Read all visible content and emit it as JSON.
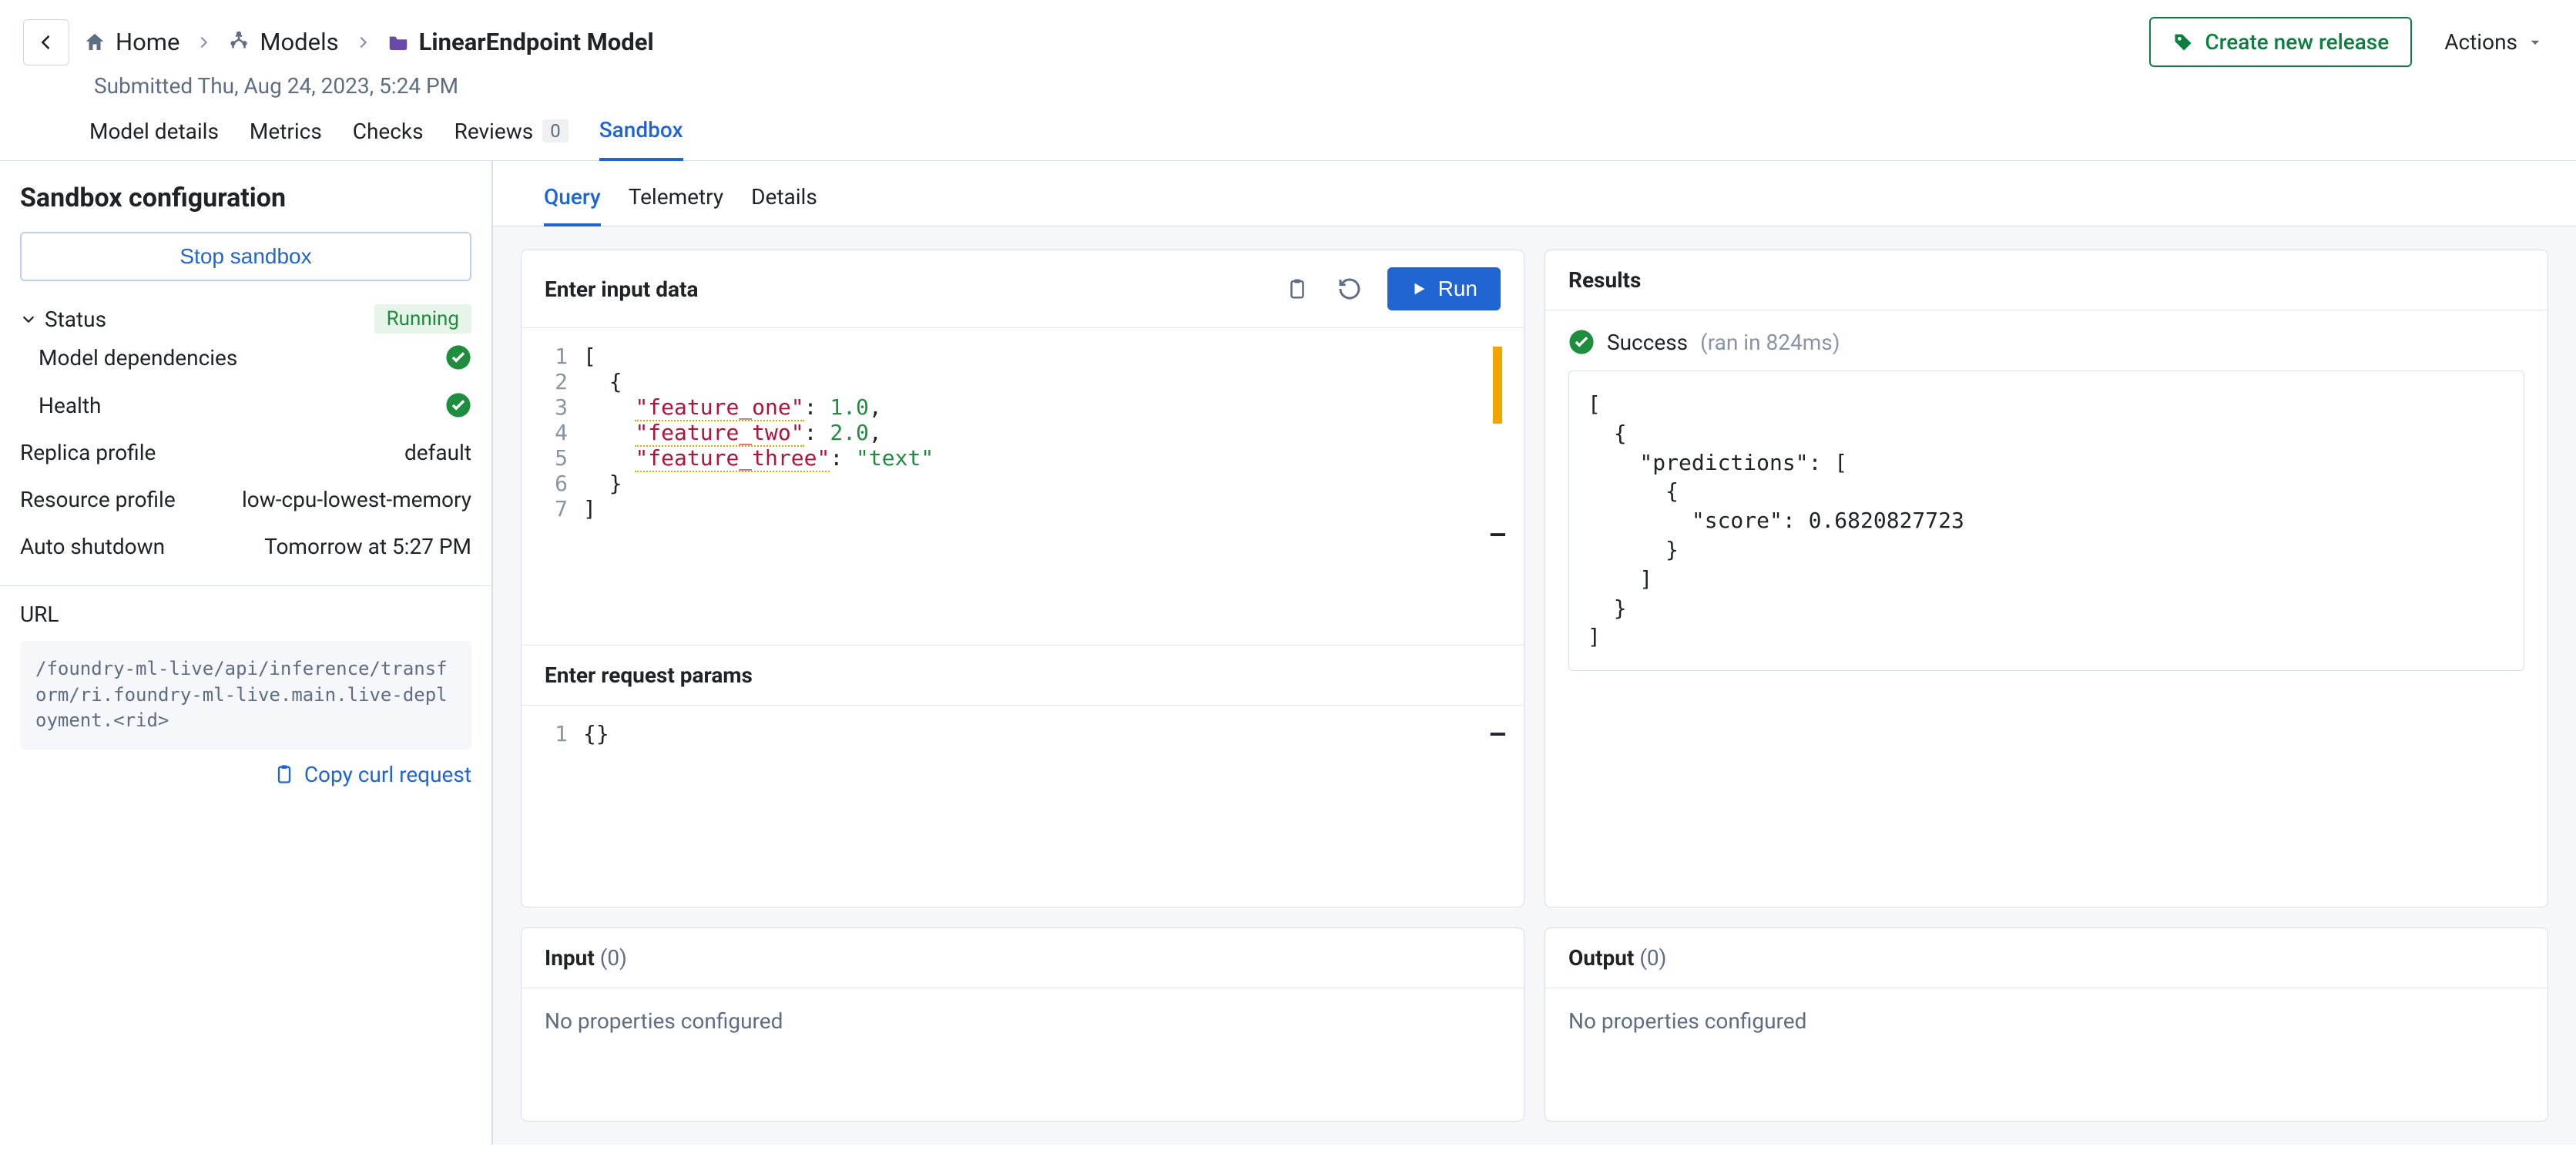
{
  "breadcrumb": {
    "home": "Home",
    "models": "Models",
    "current": "LinearEndpoint Model"
  },
  "submitted": "Submitted Thu, Aug 24, 2023, 5:24 PM",
  "header_buttons": {
    "create_release": "Create new release",
    "actions": "Actions"
  },
  "primary_tabs": {
    "model_details": "Model details",
    "metrics": "Metrics",
    "checks": "Checks",
    "reviews": "Reviews",
    "reviews_count": "0",
    "sandbox": "Sandbox"
  },
  "sidebar": {
    "title": "Sandbox configuration",
    "stop": "Stop sandbox",
    "status_label": "Status",
    "status_badge": "Running",
    "model_deps": "Model dependencies",
    "health": "Health",
    "replica_label": "Replica profile",
    "replica_value": "default",
    "resource_label": "Resource profile",
    "resource_value": "low-cpu-lowest-memory",
    "shutdown_label": "Auto shutdown",
    "shutdown_value": "Tomorrow at 5:27 PM",
    "url_label": "URL",
    "url_value": "/foundry-ml-live/api/inference/transform/ri.foundry-ml-live.main.live-deployment.<rid>",
    "copy": "Copy curl request"
  },
  "sub_tabs": {
    "query": "Query",
    "telemetry": "Telemetry",
    "details": "Details"
  },
  "query": {
    "input_title": "Enter input data",
    "run": "Run",
    "code": {
      "f1_key": "\"feature_one\"",
      "f1_val": "1.0",
      "f2_key": "\"feature_two\"",
      "f2_val": "2.0",
      "f3_key": "\"feature_three\"",
      "f3_val": "\"text\""
    },
    "params_title": "Enter request params",
    "params_code": "{}"
  },
  "results": {
    "title": "Results",
    "success": "Success",
    "ran_in": "(ran in 824ms)",
    "body": "[\n  {\n    \"predictions\": [\n      {\n        \"score\": 0.6820827723\n      }\n    ]\n  }\n]"
  },
  "io": {
    "input_title": "Input",
    "input_count": "(0)",
    "output_title": "Output",
    "output_count": "(0)",
    "none": "No properties configured"
  }
}
